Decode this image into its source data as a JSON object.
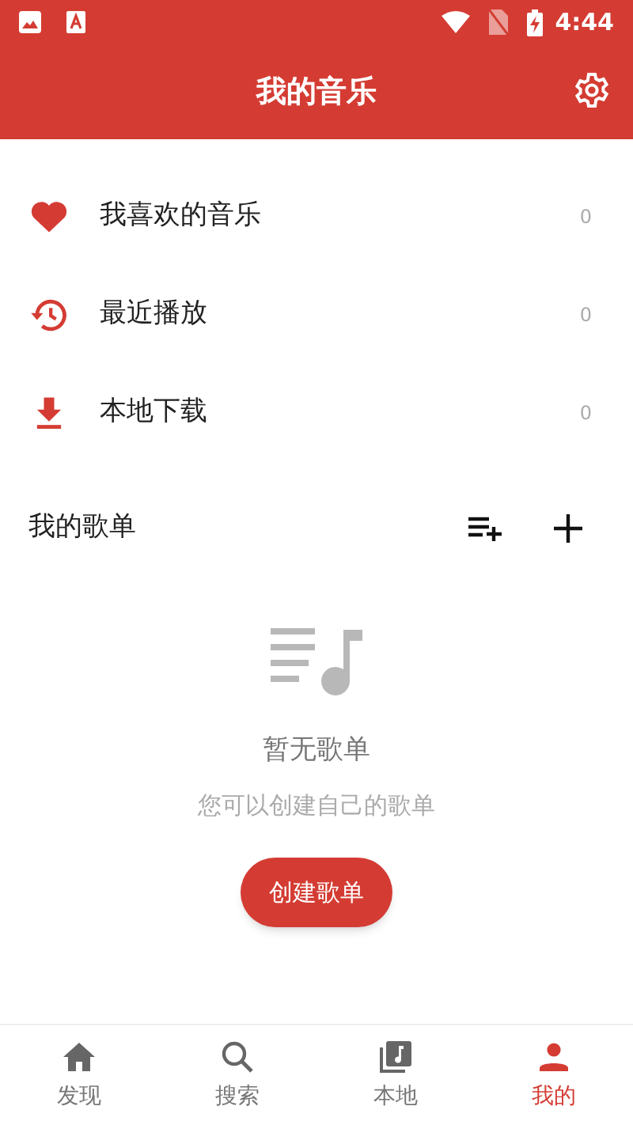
{
  "status_bar": {
    "time": "4:44"
  },
  "header": {
    "title": "我的音乐"
  },
  "shortcuts": [
    {
      "kind": "heart",
      "label": "我喜欢的音乐",
      "count": "0"
    },
    {
      "kind": "history",
      "label": "最近播放",
      "count": "0"
    },
    {
      "kind": "download",
      "label": "本地下载",
      "count": "0"
    }
  ],
  "playlists": {
    "title": "我的歌单",
    "empty_title": "暂无歌单",
    "empty_hint": "您可以创建自己的歌单",
    "create_button": "创建歌单"
  },
  "bottom_nav": [
    {
      "kind": "home",
      "label": "发现",
      "selected": false
    },
    {
      "kind": "search",
      "label": "搜索",
      "selected": false
    },
    {
      "kind": "library",
      "label": "本地",
      "selected": false
    },
    {
      "kind": "person",
      "label": "我的",
      "selected": true
    }
  ]
}
